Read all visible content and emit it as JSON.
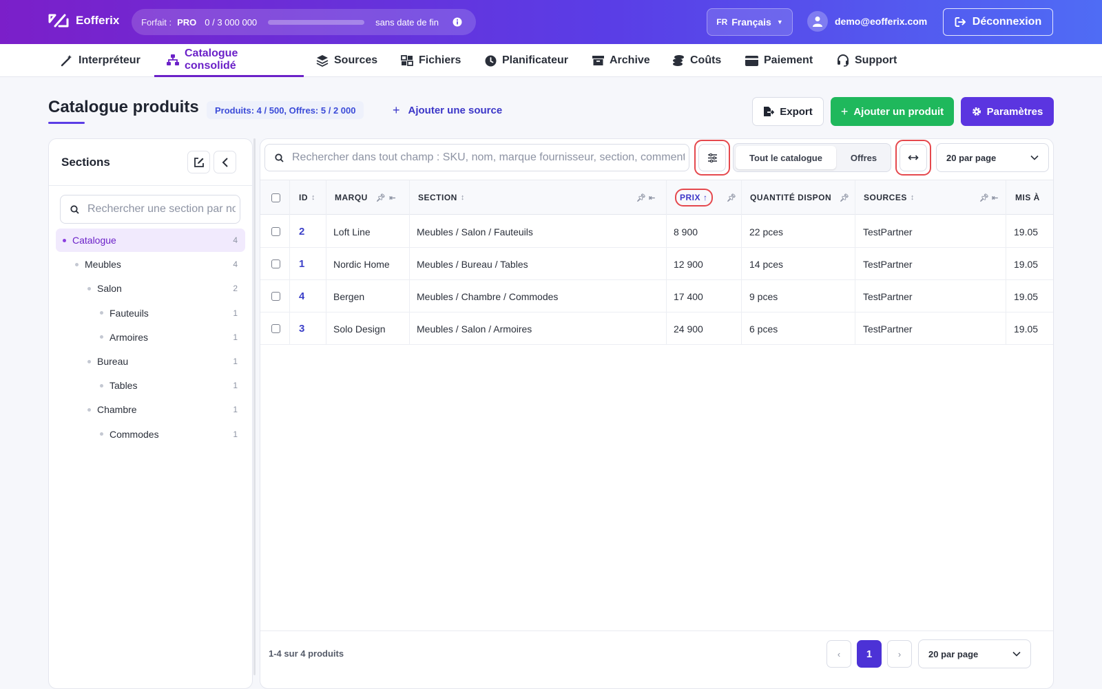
{
  "header": {
    "logo_text": "Eofferix",
    "plan_label": "Forfait :",
    "plan_name": "PRO",
    "plan_usage": "0 / 3 000 000",
    "plan_usage_fraction": 0.0,
    "plan_expiry": "sans date de fin",
    "lang_code": "FR",
    "lang_name": "Français",
    "user_email": "demo@eofferix.com",
    "logout_label": "Déconnexion",
    "colors": {
      "gradient_start": "#7b1fc9",
      "gradient_end": "#4f6cf5"
    }
  },
  "nav": {
    "items": [
      {
        "label": "Interpréteur",
        "icon": "wand-icon"
      },
      {
        "label": "Catalogue consolidé",
        "icon": "sitemap-icon",
        "active": true
      },
      {
        "label": "Sources",
        "icon": "layers-icon"
      },
      {
        "label": "Fichiers",
        "icon": "tables-icon"
      },
      {
        "label": "Planificateur",
        "icon": "clock-icon"
      },
      {
        "label": "Archive",
        "icon": "archive-box-icon"
      },
      {
        "label": "Coûts",
        "icon": "coins-icon"
      },
      {
        "label": "Paiement",
        "icon": "credit-card-icon"
      },
      {
        "label": "Support",
        "icon": "headset-icon"
      }
    ]
  },
  "page": {
    "title": "Catalogue produits",
    "counts": "Produits: 4 / 500, Offres: 5 / 2 000",
    "add_source": "Ajouter une source",
    "export_label": "Export",
    "add_product_label": "Ajouter un produit",
    "params_label": "Paramètres",
    "colors": {
      "accent": "#5b35e0",
      "success": "#1fb85c"
    }
  },
  "sidebar": {
    "title": "Sections",
    "search_placeholder": "Rechercher une section par nom",
    "tree": [
      {
        "label": "Catalogue",
        "count": "4",
        "level": 0,
        "active": true
      },
      {
        "label": "Meubles",
        "count": "4",
        "level": 1
      },
      {
        "label": "Salon",
        "count": "2",
        "level": 2
      },
      {
        "label": "Fauteuils",
        "count": "1",
        "level": 3
      },
      {
        "label": "Armoires",
        "count": "1",
        "level": 3
      },
      {
        "label": "Bureau",
        "count": "1",
        "level": 2
      },
      {
        "label": "Tables",
        "count": "1",
        "level": 3
      },
      {
        "label": "Chambre",
        "count": "1",
        "level": 2
      },
      {
        "label": "Commodes",
        "count": "1",
        "level": 3
      }
    ]
  },
  "toolbar": {
    "search_placeholder": "Rechercher dans tout champ : SKU, nom, marque fournisseur, section, commentaire",
    "scope_all": "Tout le catalogue",
    "scope_offers": "Offres",
    "per_page": "20 par page"
  },
  "table": {
    "columns": [
      {
        "label": "ID",
        "key": "id"
      },
      {
        "label": "MARQU",
        "key": "brand"
      },
      {
        "label": "SECTION",
        "key": "section"
      },
      {
        "label": "PRIX",
        "key": "price",
        "sorted": "asc"
      },
      {
        "label": "QUANTITÉ DISPON",
        "key": "qty"
      },
      {
        "label": "SOURCES",
        "key": "source"
      },
      {
        "label": "MIS À",
        "key": "updated"
      }
    ],
    "rows": [
      {
        "id": "2",
        "brand": "Loft Line",
        "section": "Meubles / Salon / Fauteuils",
        "price": "8 900",
        "qty": "22 pces",
        "source": "TestPartner",
        "updated": "19.05"
      },
      {
        "id": "1",
        "brand": "Nordic Home",
        "section": "Meubles / Bureau / Tables",
        "price": "12 900",
        "qty": "14 pces",
        "source": "TestPartner",
        "updated": "19.05"
      },
      {
        "id": "4",
        "brand": "Bergen",
        "section": "Meubles / Chambre / Commodes",
        "price": "17 400",
        "qty": "9 pces",
        "source": "TestPartner",
        "updated": "19.05"
      },
      {
        "id": "3",
        "brand": "Solo Design",
        "section": "Meubles / Salon / Armoires",
        "price": "24 900",
        "qty": "6 pces",
        "source": "TestPartner",
        "updated": "19.05"
      }
    ]
  },
  "footer": {
    "summary": "1-4 sur 4 produits",
    "prev": "‹",
    "next": "›",
    "current_page": "1",
    "per_page": "20 par page"
  }
}
